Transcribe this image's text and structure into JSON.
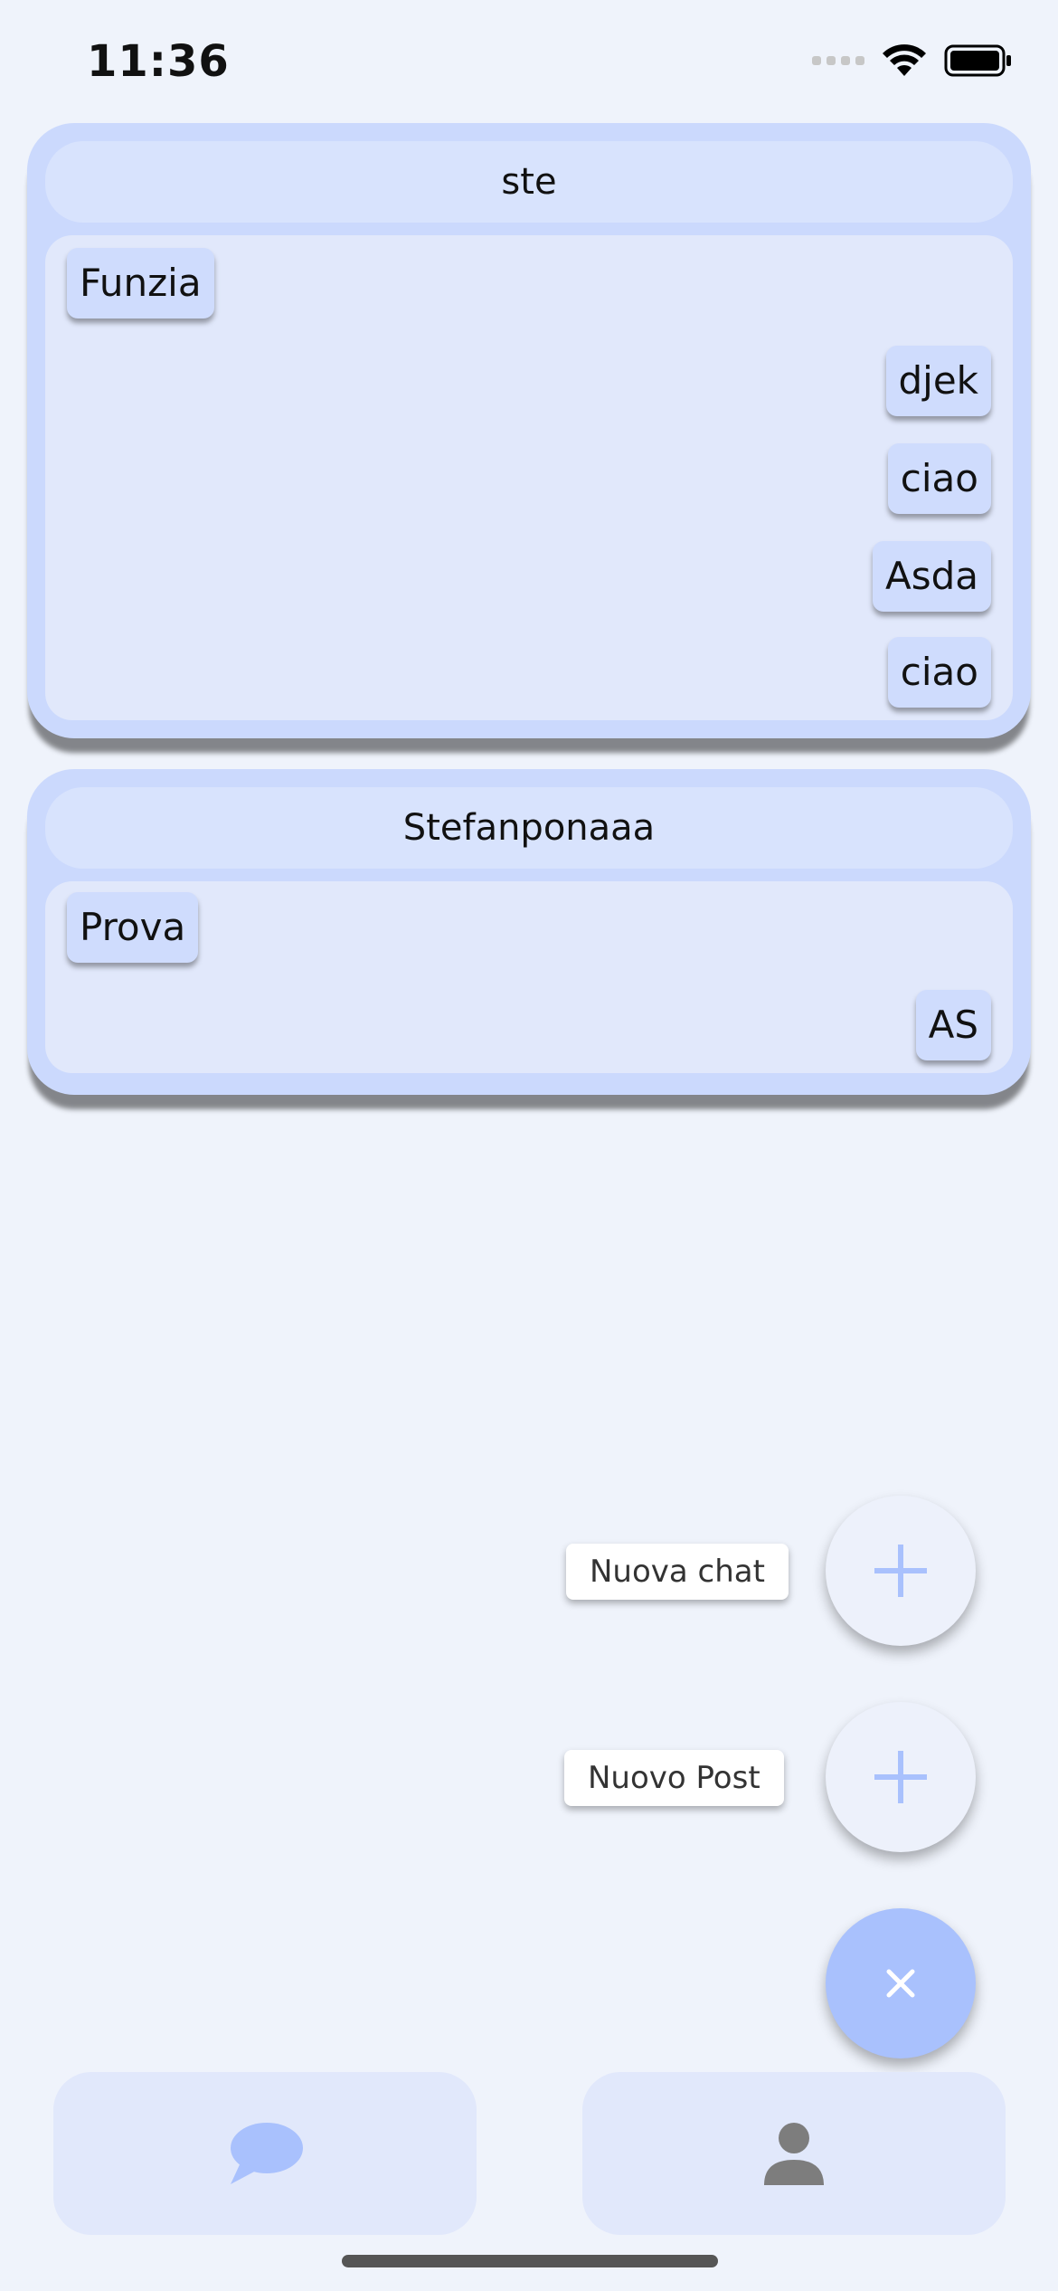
{
  "status": {
    "time": "11:36"
  },
  "chats": [
    {
      "name": "ste",
      "messages": [
        {
          "text": "Funzia",
          "side": "left"
        },
        {
          "text": "djek",
          "side": "right"
        },
        {
          "text": "ciao",
          "side": "right"
        },
        {
          "text": "Asda",
          "side": "right"
        },
        {
          "text": "ciao",
          "side": "right"
        }
      ]
    },
    {
      "name": "Stefanponaaa",
      "messages": [
        {
          "text": "Prova",
          "side": "left"
        },
        {
          "text": "AS",
          "side": "right"
        }
      ]
    }
  ],
  "fab": {
    "new_chat_label": "Nuova chat",
    "new_post_label": "Nuovo Post",
    "plus_icon": "plus-icon",
    "close_icon": "close-icon"
  },
  "nav": {
    "chat_icon": "chat-bubble-icon",
    "profile_icon": "person-icon"
  },
  "colors": {
    "background": "#eff3fb",
    "card": "#cbd9fd",
    "accent": "#a9c1fd",
    "bubble": "#cfdcfd"
  }
}
